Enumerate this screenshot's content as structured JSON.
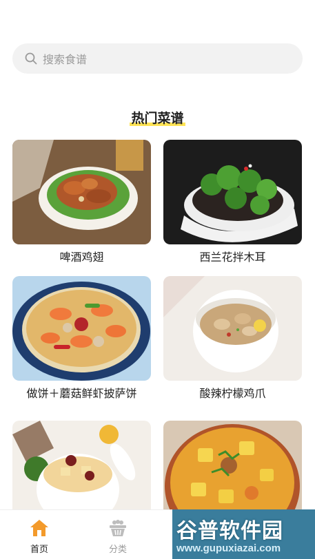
{
  "search": {
    "placeholder": "搜索食谱",
    "icon": "search-icon"
  },
  "section": {
    "title": "热门菜谱"
  },
  "recipes": [
    {
      "title": "啤酒鸡翅"
    },
    {
      "title": "西兰花拌木耳"
    },
    {
      "title": "做饼＋蘑菇鲜虾披萨饼"
    },
    {
      "title": "酸辣柠檬鸡爪"
    },
    {
      "title": ""
    },
    {
      "title": ""
    }
  ],
  "tabbar": {
    "tabs": [
      {
        "label": "首页",
        "icon": "home-icon",
        "active": true,
        "color": "#f39a2b"
      },
      {
        "label": "分类",
        "icon": "category-basket-icon",
        "active": false,
        "color": "#bdbdbd"
      }
    ]
  },
  "watermark": {
    "brand": "谷普软件园",
    "url": "www.gupuxiazai.com"
  },
  "colors": {
    "accent": "#f39a2b",
    "highlight": "#ffe455",
    "search_bg": "#f2f2f2"
  }
}
